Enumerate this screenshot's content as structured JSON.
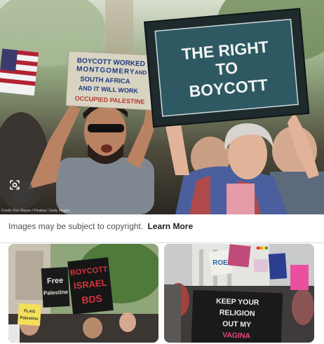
{
  "copyright_notice": {
    "text": "Images may be subject to copyright.",
    "link_label": "Learn More"
  },
  "main_image": {
    "credit": "Credit: Rick Mason / Pixabay / Getty Images",
    "center_sign": [
      "THE RIGHT",
      "TO",
      "BOYCOTT"
    ],
    "left_sign": [
      "BOYCOTT WORKED",
      "MONTGOMERY",
      "AND",
      "SOUTH AFRICA",
      "AND IT WILL WORK",
      "OCCUPIED PALESTINE"
    ]
  },
  "related_thumbnails": [
    {
      "signs": [
        [
          "Free",
          "Palestine"
        ],
        [
          "BOYCOTT",
          "ISRAEL",
          "BDS"
        ],
        [
          "FLAG",
          "Palestine"
        ]
      ]
    },
    {
      "signs": [
        [
          "KEEP YOUR",
          "RELIGION",
          "OUT MY",
          "VAGINA"
        ],
        [
          "ROE"
        ]
      ]
    }
  ],
  "icons": {
    "lens": "google-lens-icon"
  },
  "colors": {
    "link": "#202124",
    "muted_text": "#4d5156",
    "divider": "#dadce0"
  }
}
